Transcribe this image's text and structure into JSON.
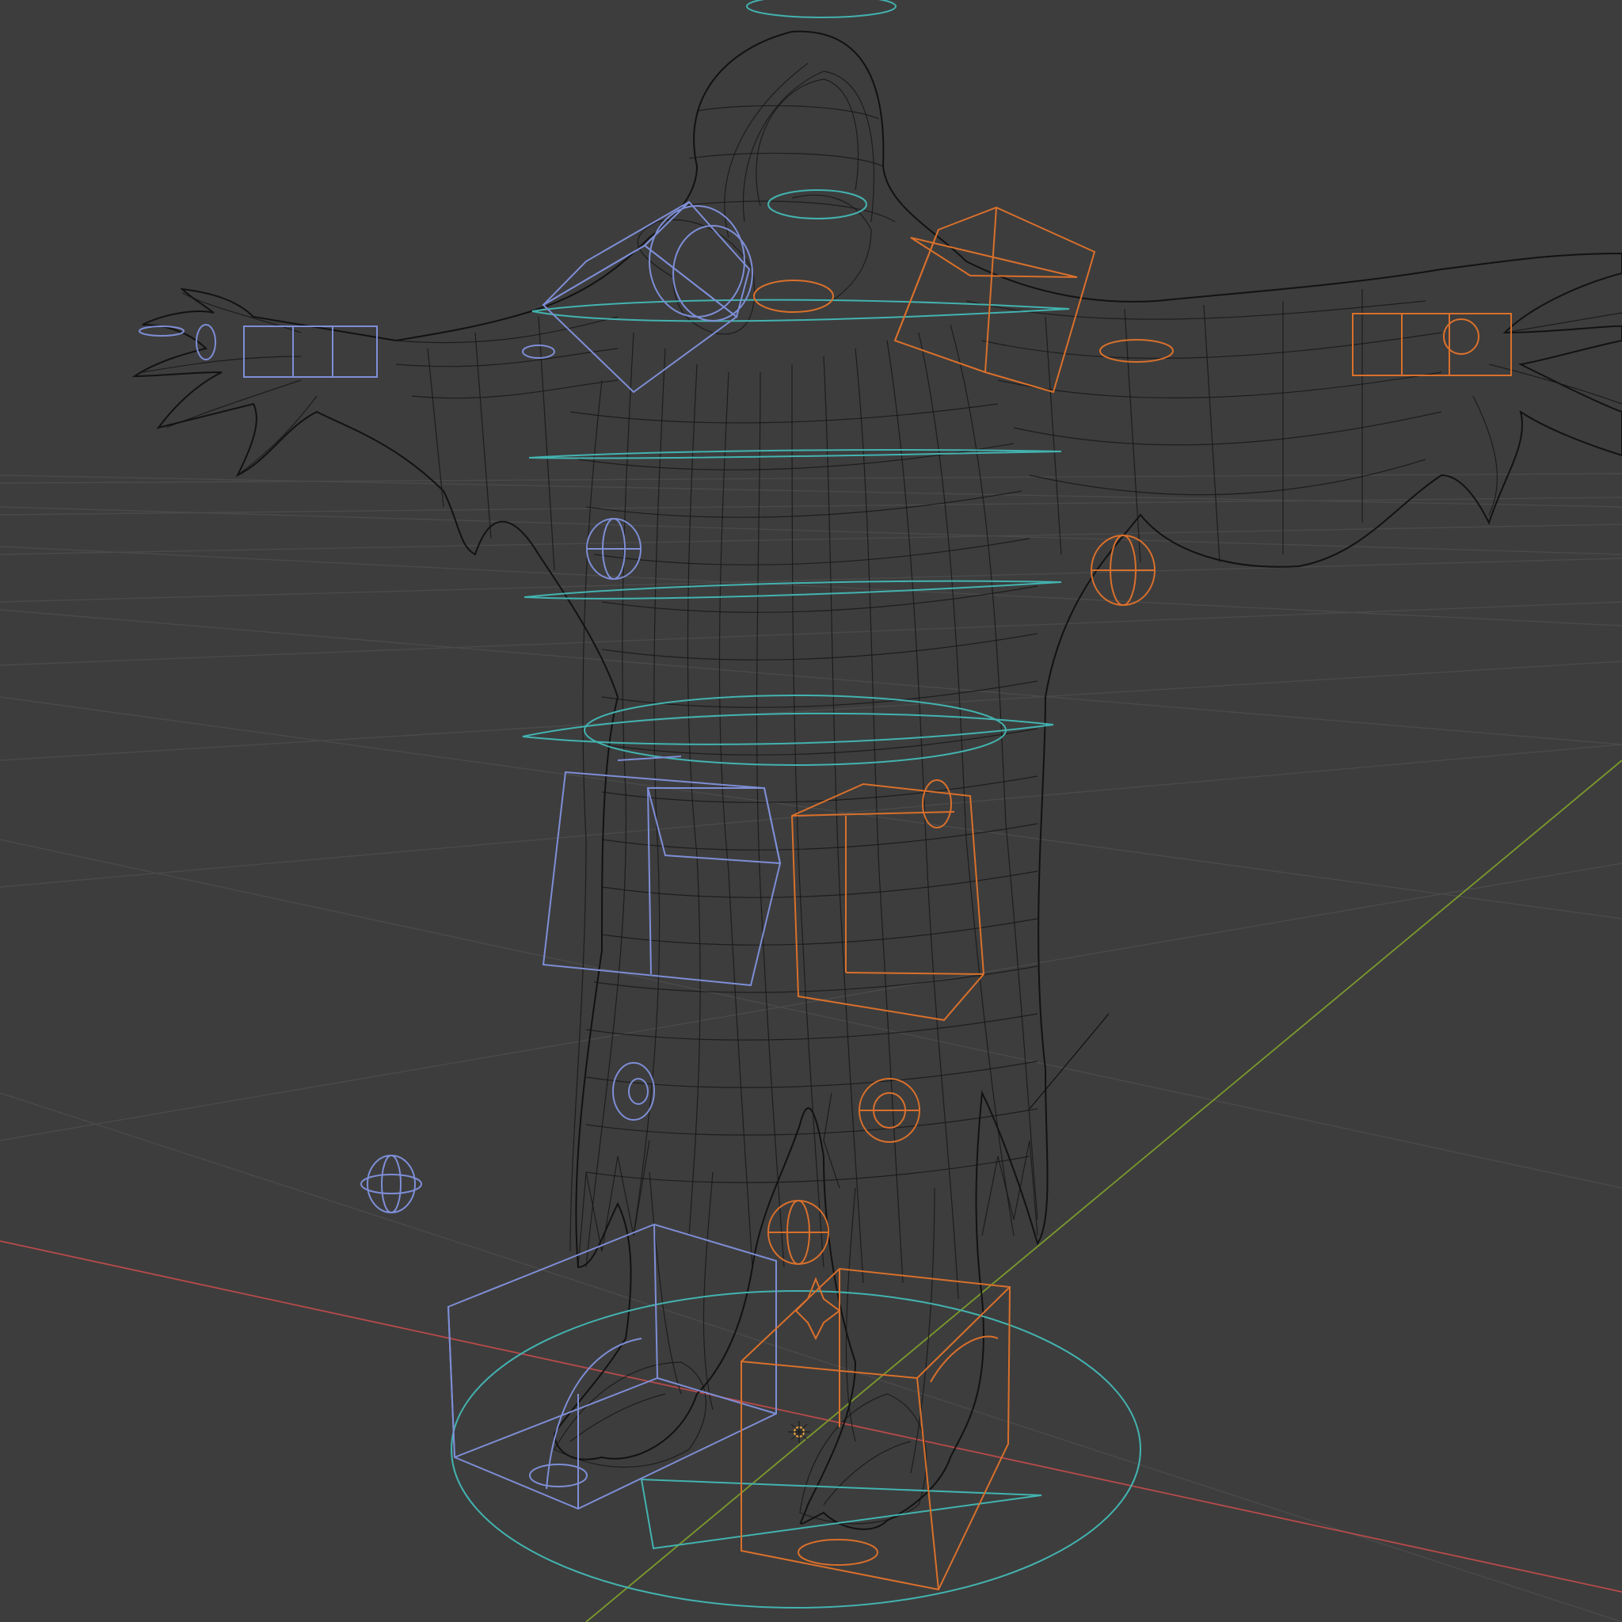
{
  "viewport": {
    "mode": "wireframe",
    "background": "#3d3d3d"
  },
  "colors": {
    "grid": "#4a4a4a",
    "x_axis": "#b84a4a",
    "y_axis": "#7c9a2c",
    "mesh": "#151515",
    "controls_left": "#7e8ed6",
    "controls_right": "#d9702c",
    "controls_center": "#43b3b0",
    "origin": "#e0a040"
  },
  "scene": {
    "object": "hooded-character-mesh",
    "pose": "T-pose",
    "rig_controls": [
      "left-side",
      "right-side",
      "center"
    ]
  }
}
